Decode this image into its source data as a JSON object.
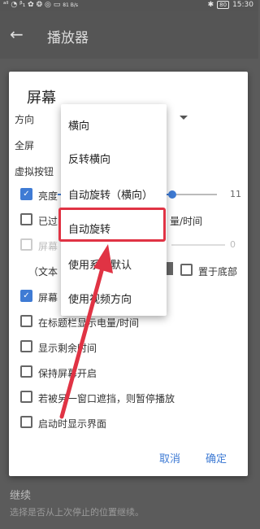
{
  "status_bar": {
    "left_icons": "ᵃˡˡ ◔ ᵝ₁ ✿ ❂ ◎ ▭",
    "speed": "81 B/s",
    "bluetooth": "✱",
    "battery": "80",
    "time": "15:30"
  },
  "app_bar": {
    "back": "←",
    "title": "播放器"
  },
  "background": {
    "item_title": "继续",
    "item_subtitle": "选择是否从上次停止的位置继续。"
  },
  "dialog": {
    "title": "屏幕",
    "orientation_label": "方向",
    "fullscreen_label": "全屏",
    "virtual_buttons_label": "虚拟按钮",
    "brightness_label": "亮度",
    "brightness_value": "11",
    "brightness_fraction": 0.72,
    "row_partial_1": "已过时",
    "row_partial_1_tail": "量/时间",
    "row_partial_2": "屏幕",
    "row_partial_2_value": "0",
    "text_label": "（文本",
    "bottom_label": "置于底部",
    "screen_row_partial": "屏幕",
    "show_battery_title": "在标题栏显示电量/时间",
    "show_remaining": "显示剩余时间",
    "keep_screen_on": "保持屏幕开启",
    "pause_if_covered": "若被另一窗口遮挡，则暂停播放",
    "show_ui_on_start": "启动时显示界面",
    "cancel": "取消",
    "ok": "确定"
  },
  "menu": {
    "items": [
      "横向",
      "反转横向",
      "自动旋转（横向）",
      "自动旋转",
      "使用系统默认",
      "使用视频方向"
    ]
  },
  "colors": {
    "accent": "#3f7bd4",
    "annotation": "#e03344"
  }
}
